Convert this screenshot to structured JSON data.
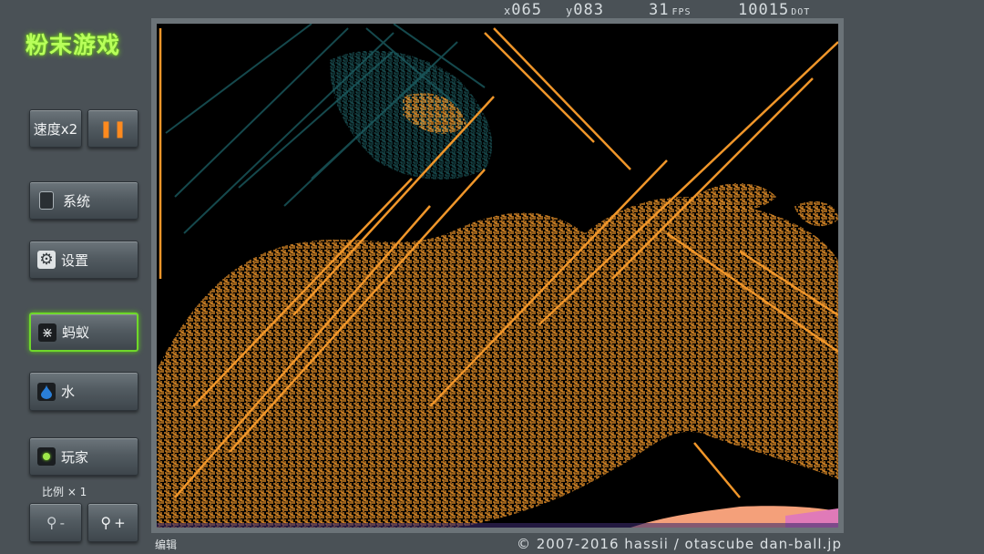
{
  "app": {
    "title": "粉末游戏"
  },
  "sidebar": {
    "speed_label": "速度x2",
    "pause_symbol": "❚❚",
    "system_label": "系统",
    "settings_label": "设置",
    "ant_label": "蚂蚁",
    "water_label": "水",
    "player_label": "玩家",
    "scale_label": "比例 × 1",
    "zoom_out_label": "-",
    "zoom_in_label": "+"
  },
  "status": {
    "x_prefix": "x",
    "x_value": "065",
    "y_prefix": "y",
    "y_value": "083",
    "fps_value": "31",
    "fps_unit": "FPS",
    "dot_value": "10015",
    "dot_unit": "DOT"
  },
  "footer": {
    "mode_label": "编辑",
    "copyright": "© 2007-2016 hassii / otascube dan-ball.jp"
  },
  "colors": {
    "accent_green": "#7fe01f",
    "pause_orange": "#ff8a1e",
    "particle_orange": "#f0962a",
    "wall_teal": "#15494d",
    "water_blue": "#2a7fd8"
  },
  "icons": {
    "system": "tablet-icon",
    "settings": "gear-icon",
    "ant": "ant-icon",
    "water": "water-drop-icon",
    "player": "player-dot-icon",
    "zoom": "magnifier-icon"
  }
}
